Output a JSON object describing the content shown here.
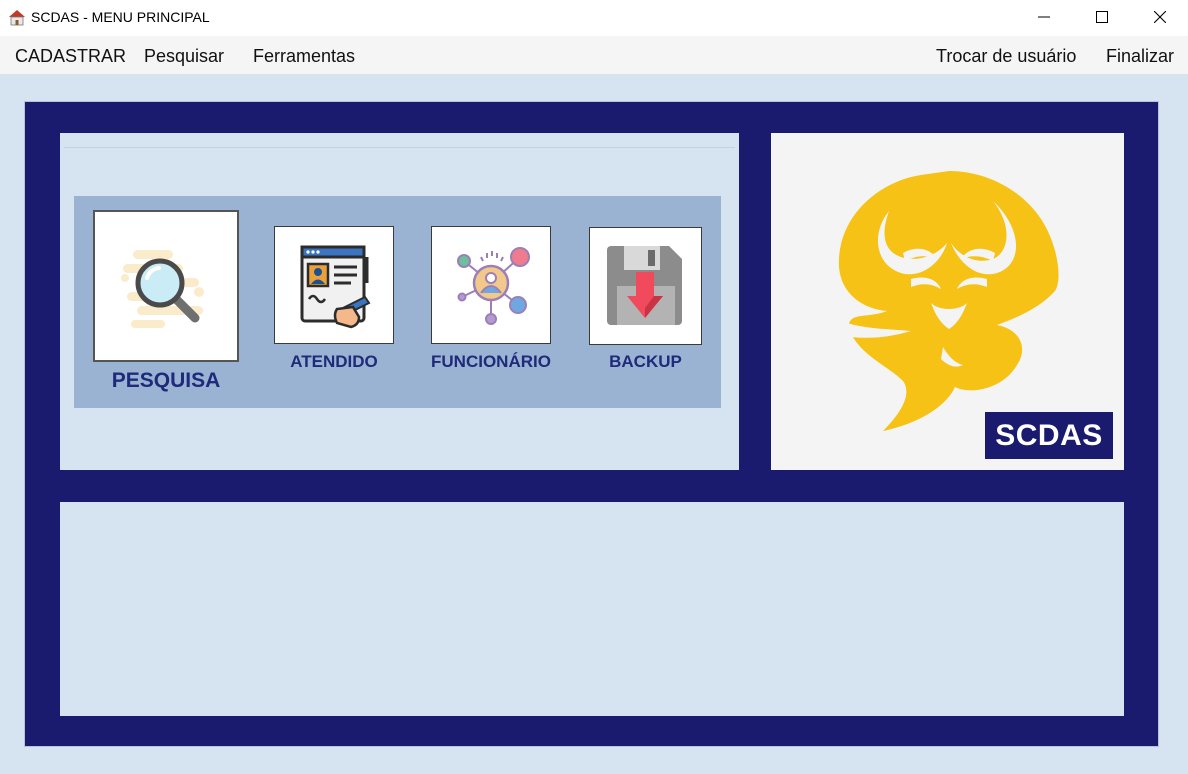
{
  "window": {
    "title": "SCDAS - MENU PRINCIPAL",
    "controls": [
      "minimize",
      "maximize",
      "close"
    ]
  },
  "menubar": {
    "left_items": [
      "CADASTRAR",
      "Pesquisar",
      "Ferramentas"
    ],
    "right_items": [
      "Trocar de usuário",
      "Finalizar"
    ]
  },
  "tiles": [
    {
      "label": "PESQUISA",
      "icon": "magnifier-icon"
    },
    {
      "label": "ATENDIDO",
      "icon": "signing-form-icon"
    },
    {
      "label": "FUNCIONÁRIO",
      "icon": "network-user-icon"
    },
    {
      "label": "BACKUP",
      "icon": "floppy-download-icon"
    }
  ],
  "brand": {
    "name": "SCDAS",
    "logo": "yellow-hands-speech-bubble-logo",
    "colors": {
      "navy": "#1a1a6e",
      "yellow": "#f5c215",
      "panel": "#d6e4f1",
      "strip": "#9ab3d2"
    }
  }
}
